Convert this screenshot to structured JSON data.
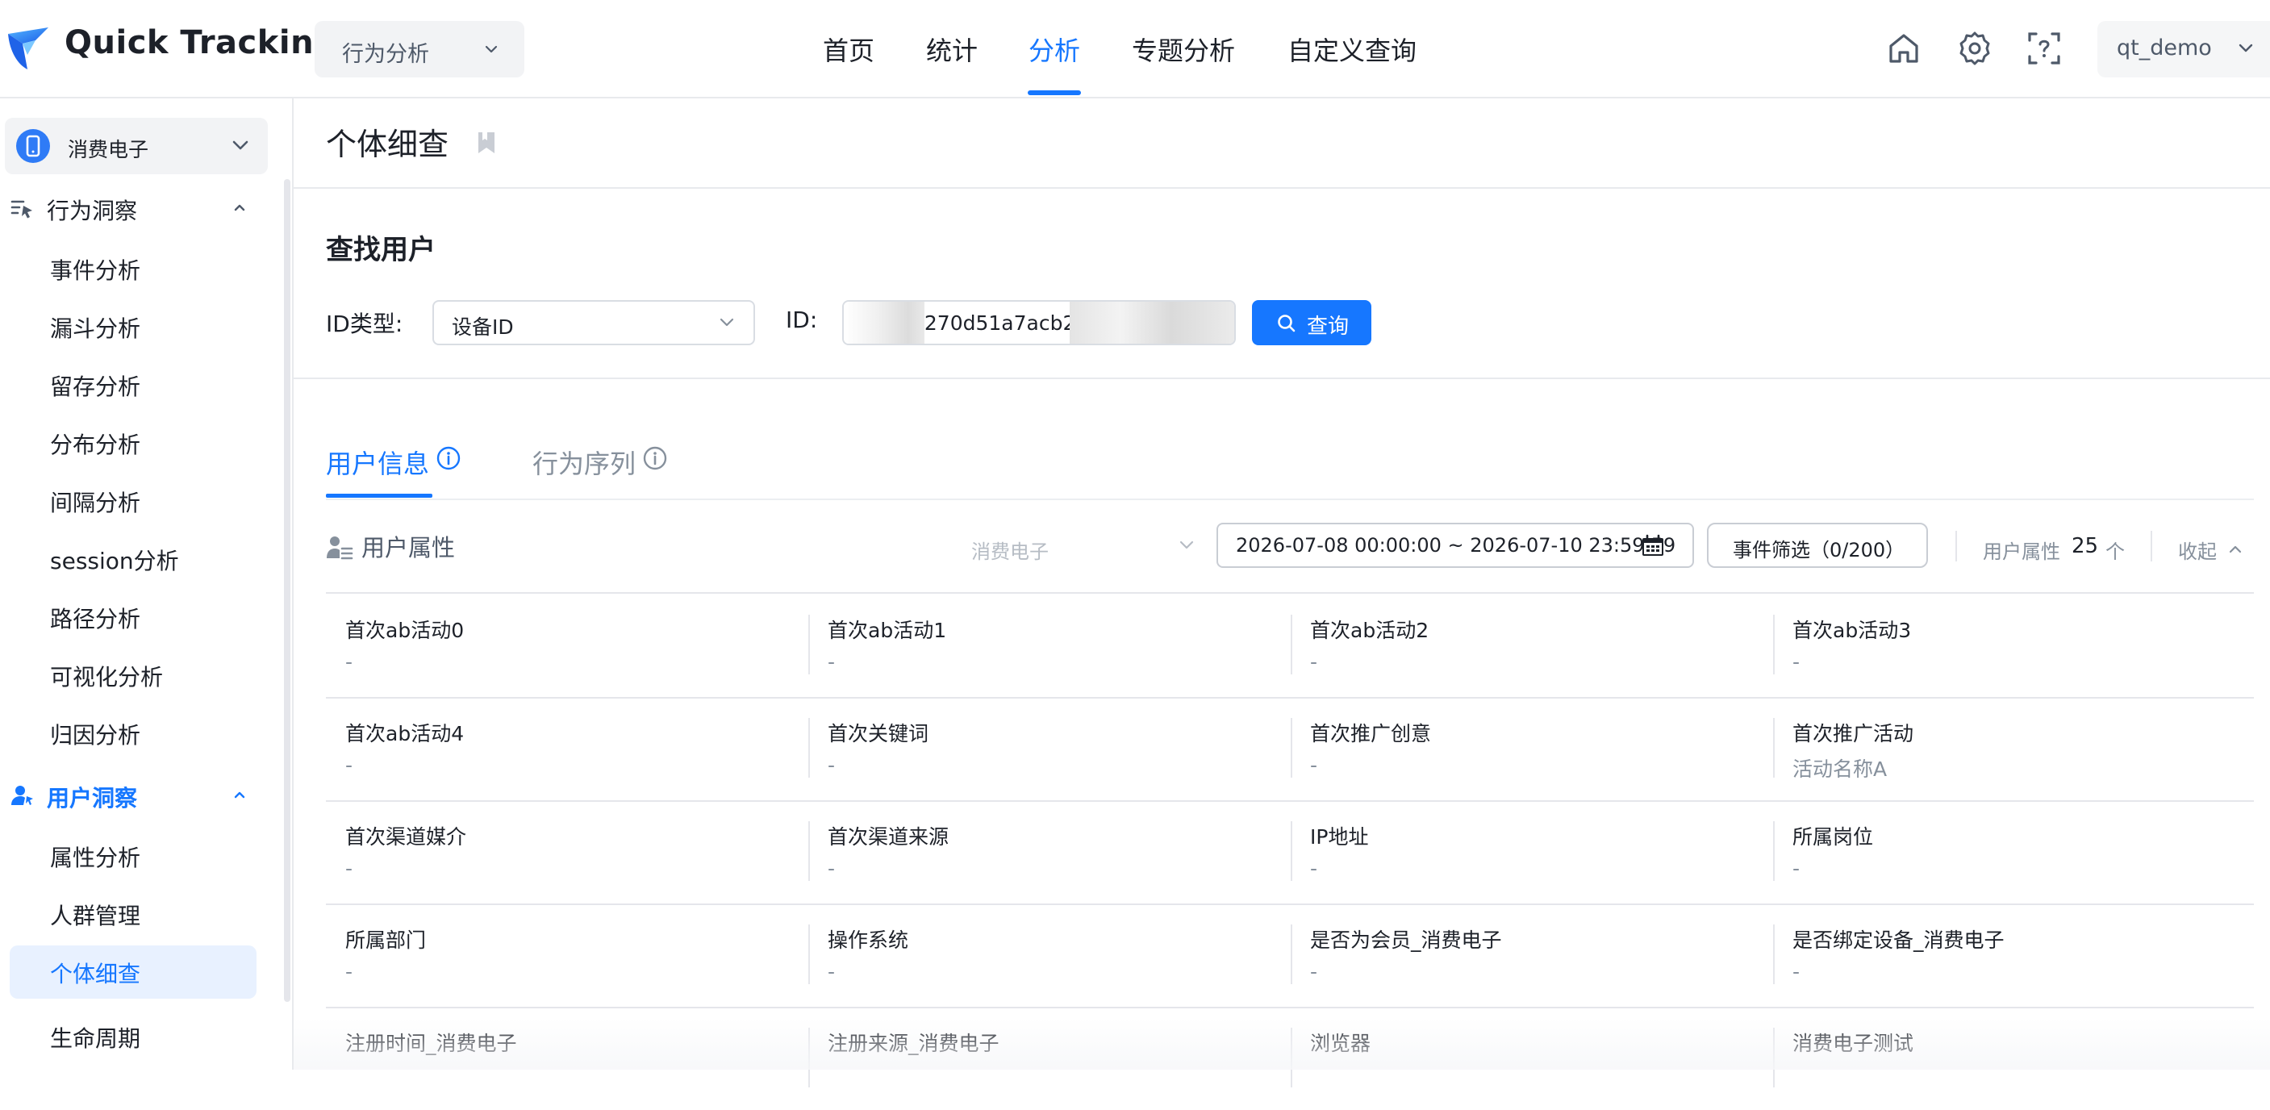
{
  "app": {
    "logo_text": "Quick Tracking",
    "module_select": "行为分析",
    "nav": [
      "首页",
      "统计",
      "分析",
      "专题分析",
      "自定义查询"
    ],
    "active_nav": "分析",
    "user": "qt_demo"
  },
  "sidebar": {
    "app_name": "消费电子",
    "group1_label": "行为洞察",
    "group1_items": [
      "事件分析",
      "漏斗分析",
      "留存分析",
      "分布分析",
      "间隔分析",
      "session分析",
      "路径分析",
      "可视化分析",
      "归因分析"
    ],
    "group2_label": "用户洞察",
    "group2_items": [
      "属性分析",
      "人群管理",
      "个体细查",
      "生命周期"
    ],
    "active_item": "个体细查"
  },
  "page": {
    "title": "个体细查",
    "find_title": "查找用户",
    "id_type_label": "ID类型:",
    "id_type_value": "设备ID",
    "id_label": "ID:",
    "id_value": "3270d51a7acb2f9",
    "query_label": "查询",
    "tabs": [
      "用户信息",
      "行为序列"
    ],
    "active_tab": "用户信息",
    "attr_section_title": "用户属性",
    "app_filter": "消费电子",
    "date_range": "2026-07-08 00:00:00 ~ 2026-07-10 23:59:59",
    "event_filter": "事件筛选（0/200）",
    "attr_count_label": "用户属性",
    "attr_count": "25",
    "attr_count_unit": "个",
    "collapse_label": "收起"
  },
  "attributes": [
    {
      "name": "首次ab活动0",
      "value": "-"
    },
    {
      "name": "首次ab活动1",
      "value": "-"
    },
    {
      "name": "首次ab活动2",
      "value": "-"
    },
    {
      "name": "首次ab活动3",
      "value": "-"
    },
    {
      "name": "首次ab活动4",
      "value": "-"
    },
    {
      "name": "首次关键词",
      "value": "-"
    },
    {
      "name": "首次推广创意",
      "value": "-"
    },
    {
      "name": "首次推广活动",
      "value": "活动名称A"
    },
    {
      "name": "首次渠道媒介",
      "value": "-"
    },
    {
      "name": "首次渠道来源",
      "value": "-"
    },
    {
      "name": "IP地址",
      "value": "-"
    },
    {
      "name": "所属岗位",
      "value": "-"
    },
    {
      "name": "所属部门",
      "value": "-"
    },
    {
      "name": "操作系统",
      "value": "-"
    },
    {
      "name": "是否为会员_消费电子",
      "value": "-"
    },
    {
      "name": "是否绑定设备_消费电子",
      "value": "-"
    },
    {
      "name": "注册时间_消费电子",
      "value": ""
    },
    {
      "name": "注册来源_消费电子",
      "value": ""
    },
    {
      "name": "浏览器",
      "value": ""
    },
    {
      "name": "消费电子测试",
      "value": ""
    }
  ],
  "colors": {
    "accent": "#1677ff",
    "active_bg": "#e8f1ff",
    "text": "#1d2129",
    "muted": "#86909c"
  },
  "icons": {
    "top_right": [
      "home-icon",
      "settings-gear-icon",
      "help-scan-icon"
    ]
  }
}
